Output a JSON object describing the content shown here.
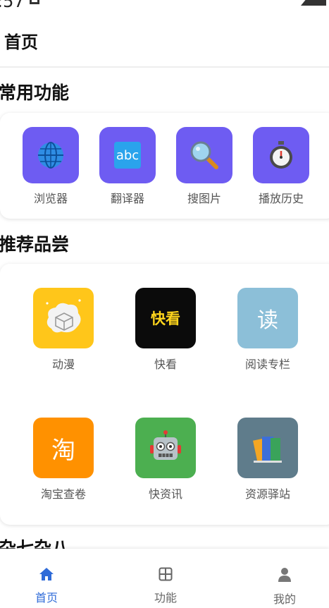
{
  "status": {
    "time": ":57"
  },
  "header": {
    "title": "首页"
  },
  "common": {
    "title": "常用功能",
    "items": [
      {
        "label": "浏览器",
        "icon": "globe-icon"
      },
      {
        "label": "翻译器",
        "icon": "abc-icon",
        "glyph": "abc"
      },
      {
        "label": "搜图片",
        "icon": "magnifier-icon"
      },
      {
        "label": "播放历史",
        "icon": "stopwatch-icon"
      }
    ]
  },
  "recommend": {
    "title": "推荐品尝",
    "items": [
      {
        "label": "动漫",
        "icon": "anime-box-icon",
        "color": "#ffc61a"
      },
      {
        "label": "快看",
        "icon": "kuaikan-logo",
        "glyph": "快看",
        "color": "#0b0b0b"
      },
      {
        "label": "阅读专栏",
        "icon": "read-icon",
        "glyph": "读",
        "color": "#8cbfd8"
      },
      {
        "label": "淘宝查卷",
        "icon": "taobao-icon",
        "glyph": "淘",
        "color": "#ff9100"
      },
      {
        "label": "快资讯",
        "icon": "robot-icon",
        "color": "#4caf50"
      },
      {
        "label": "资源驿站",
        "icon": "books-icon",
        "color": "#5f7c8b"
      }
    ]
  },
  "misc": {
    "title": "杂七杂八"
  },
  "bottom_nav": {
    "items": [
      {
        "label": "首页",
        "icon": "home-icon",
        "active": true
      },
      {
        "label": "功能",
        "icon": "grid-icon",
        "active": false
      },
      {
        "label": "我的",
        "icon": "person-icon",
        "active": false
      }
    ],
    "active_color": "#2f6bd8",
    "inactive_color": "#666666"
  }
}
